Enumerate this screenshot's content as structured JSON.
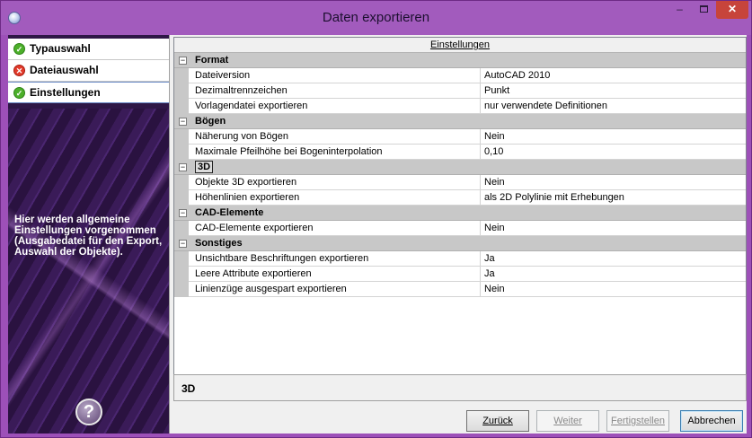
{
  "window": {
    "title": "Daten exportieren",
    "minimize": "–",
    "close": "✕"
  },
  "steps": [
    {
      "label": "Typauswahl",
      "status": "ok",
      "icon": "✓"
    },
    {
      "label": "Dateiauswahl",
      "status": "error",
      "icon": "✕"
    },
    {
      "label": "Einstellungen",
      "status": "ok",
      "icon": "✓"
    }
  ],
  "help": {
    "text": "Hier werden allgemeine Einstellungen vorgenommen (Ausgabedatei für den Export, Auswahl der Objekte).",
    "button": "?"
  },
  "grid": {
    "header": "Einstellungen",
    "collapse_glyph": "−",
    "categories": [
      {
        "name": "Format",
        "rows": [
          {
            "name": "Dateiversion",
            "value": "AutoCAD 2010"
          },
          {
            "name": "Dezimaltrennzeichen",
            "value": "Punkt"
          },
          {
            "name": "Vorlagendatei exportieren",
            "value": "nur verwendete Definitionen"
          }
        ]
      },
      {
        "name": "Bögen",
        "rows": [
          {
            "name": "Näherung von Bögen",
            "value": "Nein"
          },
          {
            "name": "Maximale Pfeilhöhe bei Bogeninterpolation",
            "value": "0,10"
          }
        ]
      },
      {
        "name": "3D",
        "rows": [
          {
            "name": "Objekte 3D exportieren",
            "value": "Nein"
          },
          {
            "name": "Höhenlinien exportieren",
            "value": "als 2D Polylinie mit Erhebungen"
          }
        ]
      },
      {
        "name": "CAD-Elemente",
        "rows": [
          {
            "name": "CAD-Elemente exportieren",
            "value": "Nein"
          }
        ]
      },
      {
        "name": "Sonstiges",
        "rows": [
          {
            "name": "Unsichtbare Beschriftungen exportieren",
            "value": "Ja"
          },
          {
            "name": "Leere Attribute exportieren",
            "value": "Ja"
          },
          {
            "name": "Linienzüge ausgespart exportieren",
            "value": "Nein"
          }
        ]
      }
    ]
  },
  "description": "3D",
  "buttons": {
    "back": "Zurück",
    "next": "Weiter",
    "finish": "Fertigstellen",
    "cancel": "Abbrechen"
  }
}
